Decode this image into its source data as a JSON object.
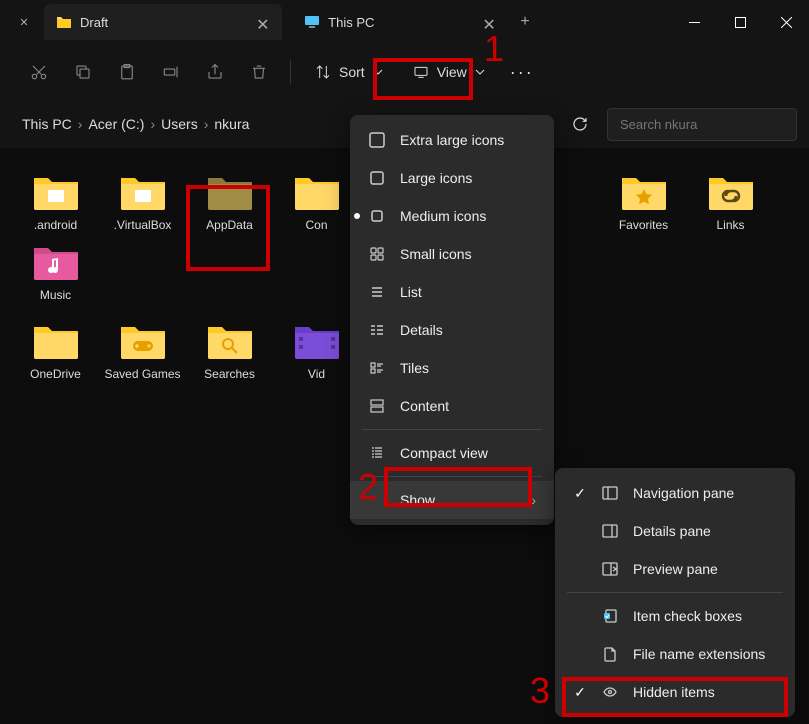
{
  "tabs": [
    {
      "label": "Draft",
      "icon": "folder"
    },
    {
      "label": "This PC",
      "icon": "pc"
    }
  ],
  "toolbar": {
    "sort_label": "Sort",
    "view_label": "View"
  },
  "breadcrumb": {
    "items": [
      "This PC",
      "Acer (C:)",
      "Users",
      "nkura"
    ]
  },
  "search": {
    "placeholder": "Search nkura"
  },
  "folders": [
    {
      "label": ".android",
      "type": "folder-doc"
    },
    {
      "label": ".VirtualBox",
      "type": "folder-doc"
    },
    {
      "label": "AppData",
      "type": "folder-hidden"
    },
    {
      "label": "Con",
      "type": "folder"
    },
    {
      "label": "Favorites",
      "type": "folder-star"
    },
    {
      "label": "Links",
      "type": "folder-link"
    },
    {
      "label": "Music",
      "type": "folder-music"
    },
    {
      "label": "OneDrive",
      "type": "folder"
    },
    {
      "label": "Saved Games",
      "type": "folder-game"
    },
    {
      "label": "Searches",
      "type": "folder-search"
    },
    {
      "label": "Vid",
      "type": "folder-video"
    }
  ],
  "view_menu": {
    "items": [
      {
        "label": "Extra large icons",
        "icon": "square-lg"
      },
      {
        "label": "Large icons",
        "icon": "square-md"
      },
      {
        "label": "Medium icons",
        "icon": "square-sm",
        "bullet": true
      },
      {
        "label": "Small icons",
        "icon": "grid"
      },
      {
        "label": "List",
        "icon": "list"
      },
      {
        "label": "Details",
        "icon": "details"
      },
      {
        "label": "Tiles",
        "icon": "tiles"
      },
      {
        "label": "Content",
        "icon": "content"
      },
      {
        "label": "Compact view",
        "icon": "compact",
        "separator_before": true
      },
      {
        "label": "Show",
        "icon": "",
        "chevron": true,
        "separator_before": true,
        "selected": true
      }
    ]
  },
  "show_menu": {
    "items": [
      {
        "label": "Navigation pane",
        "icon": "pane-nav",
        "checked": true
      },
      {
        "label": "Details pane",
        "icon": "pane-details"
      },
      {
        "label": "Preview pane",
        "icon": "pane-preview"
      },
      {
        "label": "Item check boxes",
        "icon": "checkbox",
        "separator_before": true
      },
      {
        "label": "File name extensions",
        "icon": "file"
      },
      {
        "label": "Hidden items",
        "icon": "eye",
        "checked": true
      }
    ]
  },
  "annotations": {
    "a1": "1",
    "a2": "2",
    "a3": "3"
  }
}
